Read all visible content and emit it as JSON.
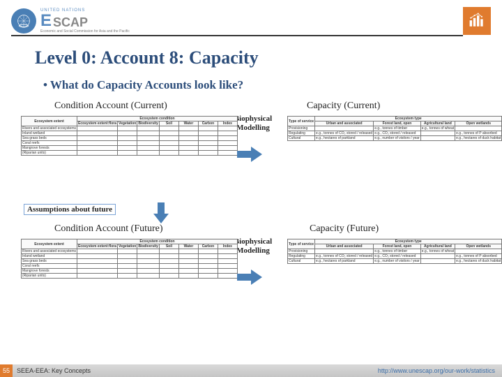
{
  "header": {
    "org_top": "UNITED NATIONS",
    "escap_E": "E",
    "escap_rest": "SCAP",
    "subtitle": "Economic and Social Commission for Asia and the Pacific"
  },
  "title": "Level 0: Account 8: Capacity",
  "bullet": "What do Capacity Accounts look like?",
  "labels": {
    "cond_current": "Condition Account (Current)",
    "cap_current": "Capacity (Current)",
    "cond_future": "Condition Account (Future)",
    "cap_future": "Capacity (Future)",
    "biophys": "Biophysical\nModelling",
    "assumptions": "Assumptions about future"
  },
  "condition_table": {
    "super": "Ecosystem condition",
    "cols": [
      "Ecosystem extent",
      "Ecosystem extent:flora",
      "Vegetation",
      "Biodiversity",
      "Soil",
      "Water",
      "Carbon",
      "Index"
    ],
    "rows": [
      "Rivers and associated ecosystems",
      "Inland wetland",
      "Sea grass beds",
      "Coral reefs",
      "Mangrove forests",
      "(Riparian units)"
    ]
  },
  "capacity_table": {
    "super": "Ecosystem type",
    "cols": [
      "Type of service",
      "Urban and associated",
      "Forest land, open",
      "Agricultural land",
      "Open wetlands"
    ],
    "rows": [
      {
        "h": "Provisioning",
        "cells": [
          "",
          "e.g., tonnes of timber",
          "e.g., tonnes of wheat",
          ""
        ]
      },
      {
        "h": "Regulating",
        "cells": [
          "e.g., tonnes of CO₂ stored / released",
          "e.g., CO₂ stored / released",
          "",
          "e.g., tonnes of P absorbed"
        ]
      },
      {
        "h": "Cultural",
        "cells": [
          "e.g., hectares of parkland",
          "e.g., number of visitors / year",
          "",
          "e.g., hectares of duck habitat"
        ]
      }
    ]
  },
  "footer": {
    "page": "55",
    "left": "SEEA-EEA: Key Concepts",
    "right": "http://www.unescap.org/our-work/statistics"
  }
}
